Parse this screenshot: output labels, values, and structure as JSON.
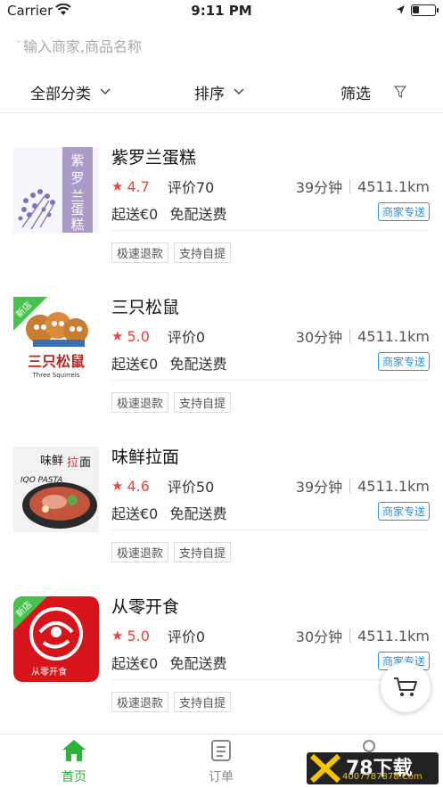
{
  "status_bar": {
    "carrier": "Carrier",
    "time": "9:11 PM"
  },
  "search": {
    "placeholder": "输入商家,商品名称"
  },
  "filters": {
    "category": "全部分类",
    "sort": "排序",
    "filter": "筛选"
  },
  "shops": [
    {
      "name": "紫罗兰蛋糕",
      "rating": "4.7",
      "reviews": "评价70",
      "time": "39分钟",
      "distance": "4511.1km",
      "min_order": "起送€0",
      "delivery_fee": "免配送费",
      "delivery_type": "商家专送",
      "tags": [
        "极速退款",
        "支持自提"
      ],
      "is_new": false,
      "logo_text": "紫罗兰蛋糕",
      "new_label": ""
    },
    {
      "name": "三只松鼠",
      "rating": "5.0",
      "reviews": "评价0",
      "time": "30分钟",
      "distance": "4511.1km",
      "min_order": "起送€0",
      "delivery_fee": "免配送费",
      "delivery_type": "商家专送",
      "tags": [
        "极速退款",
        "支持自提"
      ],
      "is_new": true,
      "logo_text": "三只松鼠",
      "logo_sub": "Three Squirrels",
      "new_label": "新店"
    },
    {
      "name": "味鲜拉面",
      "rating": "4.6",
      "reviews": "评价50",
      "time": "39分钟",
      "distance": "4511.1km",
      "min_order": "起送€0",
      "delivery_fee": "免配送费",
      "delivery_type": "商家专送",
      "tags": [
        "极速退款",
        "支持自提"
      ],
      "is_new": false,
      "logo_text": "味鲜拉面",
      "new_label": ""
    },
    {
      "name": "从零开食",
      "rating": "5.0",
      "reviews": "评价0",
      "time": "30分钟",
      "distance": "4511.1km",
      "min_order": "起送€0",
      "delivery_fee": "免配送费",
      "delivery_type": "商家专送",
      "tags": [
        "极速退款",
        "支持自提"
      ],
      "is_new": true,
      "logo_text": "从零开食",
      "new_label": "新店"
    }
  ],
  "tabbar": {
    "home": "首页",
    "orders": "订单"
  },
  "watermark": {
    "big": "78下载",
    "small": "4007787878.Com"
  },
  "colors": {
    "accent_green": "#2db53a",
    "rating_red": "#f0433a",
    "delivery_blue": "#2b90e0"
  }
}
